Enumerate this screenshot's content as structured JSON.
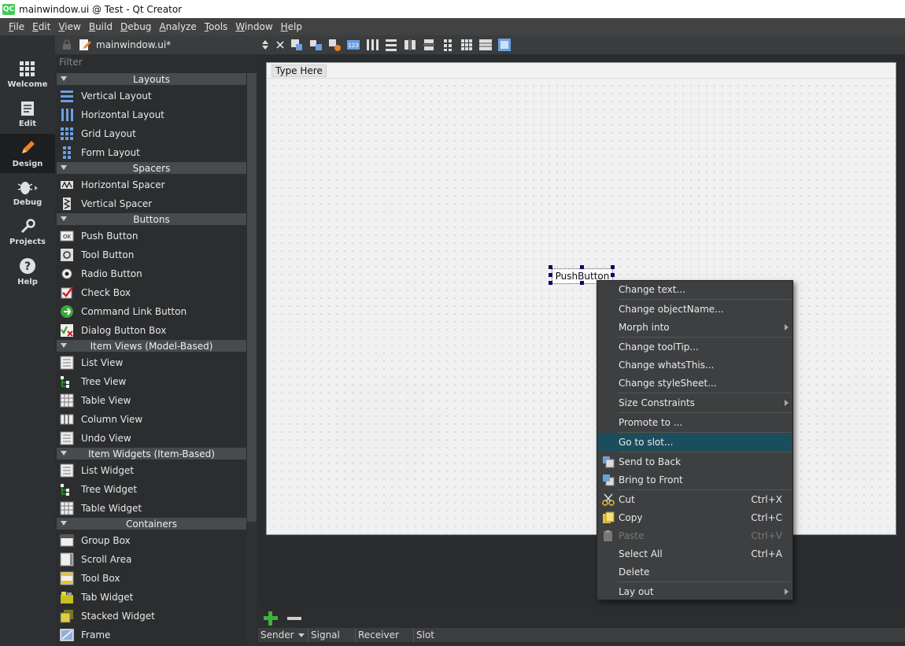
{
  "window": {
    "title": "mainwindow.ui @ Test - Qt Creator",
    "icon_text": "QC"
  },
  "menubar": {
    "items": [
      {
        "pre": "",
        "u": "F",
        "post": "ile"
      },
      {
        "pre": "",
        "u": "E",
        "post": "dit"
      },
      {
        "pre": "",
        "u": "V",
        "post": "iew"
      },
      {
        "pre": "",
        "u": "B",
        "post": "uild"
      },
      {
        "pre": "",
        "u": "D",
        "post": "ebug"
      },
      {
        "pre": "",
        "u": "A",
        "post": "nalyze"
      },
      {
        "pre": "",
        "u": "T",
        "post": "ools"
      },
      {
        "pre": "",
        "u": "W",
        "post": "indow"
      },
      {
        "pre": "",
        "u": "H",
        "post": "elp"
      }
    ]
  },
  "modes": [
    {
      "label": "Welcome",
      "icon": "grid-icon"
    },
    {
      "label": "Edit",
      "icon": "document-icon"
    },
    {
      "label": "Design",
      "icon": "pencil-icon"
    },
    {
      "label": "Debug",
      "icon": "bug-icon"
    },
    {
      "label": "Projects",
      "icon": "wrench-icon"
    },
    {
      "label": "Help",
      "icon": "help-icon"
    }
  ],
  "document_tab": {
    "title": "mainwindow.ui*"
  },
  "filter": {
    "placeholder": "Filter"
  },
  "widgetbox": [
    {
      "category": "Layouts",
      "items": [
        "Vertical Layout",
        "Horizontal Layout",
        "Grid Layout",
        "Form Layout"
      ]
    },
    {
      "category": "Spacers",
      "items": [
        "Horizontal Spacer",
        "Vertical Spacer"
      ]
    },
    {
      "category": "Buttons",
      "items": [
        "Push Button",
        "Tool Button",
        "Radio Button",
        "Check Box",
        "Command Link Button",
        "Dialog Button Box"
      ]
    },
    {
      "category": "Item Views (Model-Based)",
      "items": [
        "List View",
        "Tree View",
        "Table View",
        "Column View",
        "Undo View"
      ]
    },
    {
      "category": "Item Widgets (Item-Based)",
      "items": [
        "List Widget",
        "Tree Widget",
        "Table Widget"
      ]
    },
    {
      "category": "Containers",
      "items": [
        "Group Box",
        "Scroll Area",
        "Tool Box",
        "Tab Widget",
        "Stacked Widget",
        "Frame"
      ]
    }
  ],
  "form": {
    "menubar_placeholder": "Type Here",
    "pushbutton_text": "PushButton"
  },
  "context_menu": {
    "items": [
      {
        "label": "Change text...",
        "u": "",
        "shortcut": "",
        "submenu": false
      },
      {
        "label": "Change objectName...",
        "shortcut": "",
        "submenu": false
      },
      {
        "label": "Morph into",
        "shortcut": "",
        "submenu": true
      },
      {
        "label": "Change toolTip...",
        "shortcut": "",
        "submenu": false
      },
      {
        "label": "Change whatsThis...",
        "shortcut": "",
        "submenu": false
      },
      {
        "label": "Change styleSheet...",
        "shortcut": "",
        "submenu": false
      },
      {
        "label": "Size Constraints",
        "shortcut": "",
        "submenu": true
      },
      {
        "label": "Promote to ...",
        "shortcut": "",
        "submenu": false
      },
      {
        "label": "Go to slot...",
        "shortcut": "",
        "submenu": false
      },
      {
        "label": "Send to Back",
        "shortcut": "",
        "submenu": false
      },
      {
        "label": "Bring to Front",
        "shortcut": "",
        "submenu": false
      },
      {
        "label": "Cut",
        "shortcut": "Ctrl+X",
        "submenu": false
      },
      {
        "label": "Copy",
        "shortcut": "Ctrl+C",
        "submenu": false
      },
      {
        "label": "Paste",
        "shortcut": "Ctrl+V",
        "submenu": false
      },
      {
        "label": "Select All",
        "shortcut": "Ctrl+A",
        "submenu": false
      },
      {
        "label": "Delete",
        "shortcut": "",
        "submenu": false
      },
      {
        "label": "Lay out",
        "shortcut": "",
        "submenu": true
      }
    ],
    "highlighted": "Go to slot...",
    "disabled": "Paste"
  },
  "signal_slot": {
    "columns": [
      "Sender",
      "Signal",
      "Receiver",
      "Slot"
    ]
  },
  "colors": {
    "menu_highlight": "#1b4e5c",
    "accent_orange": "#e8832a",
    "add_green": "#3cb23c"
  }
}
